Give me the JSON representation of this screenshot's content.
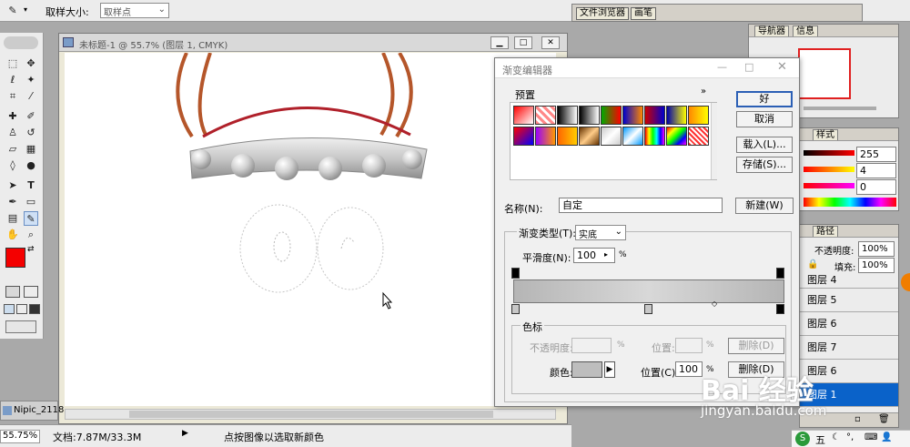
{
  "options_bar": {
    "sample_size_label": "取样大小:",
    "sample_size_value": "取样点"
  },
  "dock": {
    "tabs": [
      "文件浏览器",
      "画笔"
    ]
  },
  "document": {
    "title": "未标题-1 @ 55.7% (图层 1, CMYK)",
    "zoom": "55.75%",
    "doc_size": "文档:7.87M/33.3M",
    "status_hint": "点按图像以选取新颜色",
    "second_doc": "Nipic_2118"
  },
  "navigator": {
    "tabs": [
      "导航器",
      "信息"
    ]
  },
  "color_panel": {
    "tab": "样式",
    "values": [
      "255",
      "4",
      "0"
    ]
  },
  "layers_panel": {
    "tab": "路径",
    "opacity_label": "不透明度:",
    "opacity_value": "100%",
    "fill_label": "填充:",
    "fill_value": "100%",
    "layers": [
      "图层 4",
      "图层 5",
      "图层 6",
      "图层 7",
      "图层 6",
      "图层 1"
    ]
  },
  "gradient_editor": {
    "title": "渐变编辑器",
    "presets_label": "预置",
    "ok_label": "好",
    "cancel_label": "取消",
    "load_label": "载入(L)...",
    "save_label": "存储(S)...",
    "name_label": "名称(N):",
    "name_value": "自定",
    "new_label": "新建(W)",
    "type_label": "渐变类型(T):",
    "type_value": "实底",
    "smooth_label": "平滑度(N):",
    "smooth_value": "100",
    "pct": "%",
    "stops_label": "色标",
    "opacity_label": "不透明度:",
    "position_label": "位置:",
    "delete_label": "删除(D)",
    "color_label": "颜色:",
    "position_c_label": "位置(C):",
    "position_c_value": "100",
    "delete2_label": "删除(D)"
  },
  "watermark": {
    "brand": "Bai 经验",
    "url": "jingyan.baidu.com"
  },
  "taskbar": {
    "ime": "五"
  }
}
